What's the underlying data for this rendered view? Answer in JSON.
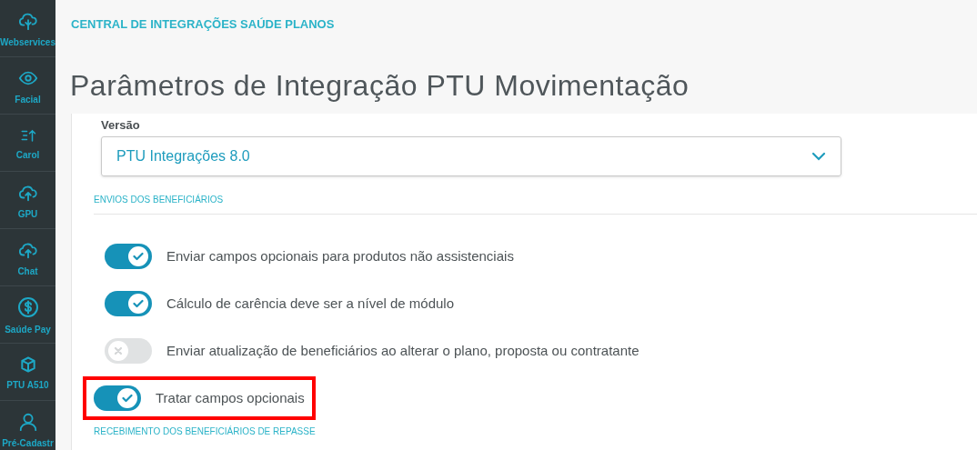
{
  "sidebar": {
    "items": [
      {
        "label": "Webservices"
      },
      {
        "label": "Facial"
      },
      {
        "label": "Carol"
      },
      {
        "label": "GPU"
      },
      {
        "label": "Chat"
      },
      {
        "label": "Saúde Pay"
      },
      {
        "label": "PTU A510"
      },
      {
        "label": "Pré-Cadastr"
      }
    ]
  },
  "breadcrumb": "CENTRAL DE INTEGRAÇÕES SAÚDE PLANOS",
  "title": "Parâmetros de Integração PTU Movimentação",
  "version_field": {
    "label": "Versão",
    "value": "PTU Integrações 8.0"
  },
  "sections": [
    {
      "heading": "ENVIOS DOS BENEFICIÁRIOS",
      "toggles": [
        {
          "label": "Enviar campos opcionais para produtos não assistenciais",
          "on": true,
          "highlighted": false
        },
        {
          "label": "Cálculo de carência deve ser a nível de módulo",
          "on": true,
          "highlighted": false
        },
        {
          "label": "Enviar atualização de beneficiários ao alterar o plano, proposta ou contratante",
          "on": false,
          "highlighted": false
        },
        {
          "label": "Tratar campos opcionais",
          "on": true,
          "highlighted": true
        }
      ]
    },
    {
      "heading": "RECEBIMENTO DOS BENEFICIÁRIOS DE REPASSE"
    }
  ]
}
